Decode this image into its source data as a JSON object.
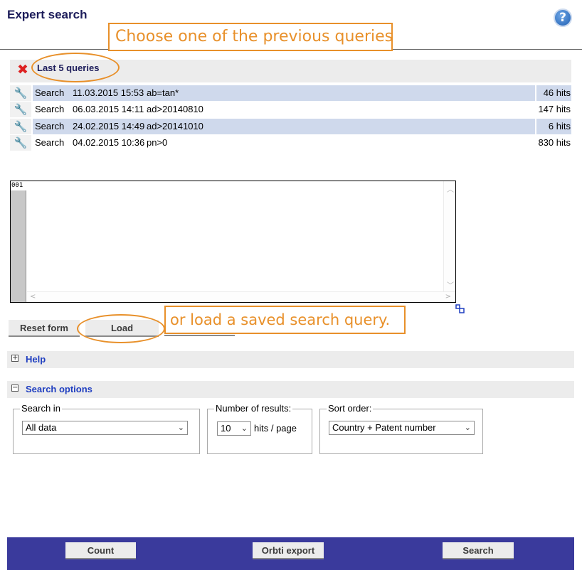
{
  "header": {
    "title": "Expert search",
    "help_glyph": "?"
  },
  "annotations": {
    "previous_queries": "Choose one of the previous queries",
    "load_saved": "or load a saved search query."
  },
  "last_queries": {
    "title": "Last 5 queries",
    "rows": [
      {
        "action": "Search",
        "date": "11.03.2015 15:53",
        "query": "ab=tan*",
        "hits": "46 hits"
      },
      {
        "action": "Search",
        "date": "06.03.2015 14:11",
        "query": "ad>20140810",
        "hits": "147 hits"
      },
      {
        "action": "Search",
        "date": "24.02.2015 14:49",
        "query": "ad>20141010",
        "hits": "6 hits"
      },
      {
        "action": "Search",
        "date": "04.02.2015 10:36",
        "query": "pn>0",
        "hits": "830 hits"
      }
    ]
  },
  "editor": {
    "line_number": "001",
    "value": ""
  },
  "form_buttons": {
    "reset": "Reset form",
    "load": "Load"
  },
  "sections": {
    "help": "Help",
    "search_options": "Search options"
  },
  "options": {
    "search_in": {
      "legend": "Search in",
      "selected": "All data"
    },
    "results": {
      "legend": "Number of results:",
      "selected": "10",
      "suffix": "hits / page"
    },
    "sort": {
      "legend": "Sort order:",
      "selected": "Country + Patent number"
    }
  },
  "footer": {
    "count": "Count",
    "orbti_export": "Orbti export",
    "search": "Search"
  },
  "colors": {
    "accent_orange": "#e8902a",
    "title_navy": "#1c1c5a",
    "link_blue": "#1f3ec0",
    "footer_bar": "#3a3a9c",
    "row_highlight": "#cfd9ec"
  },
  "icons": {
    "help": "help-icon",
    "remove": "close-x-icon",
    "row_action": "wrench-icon",
    "expand": "plus-box-icon",
    "collapse": "minus-box-icon",
    "dropdown": "chevron-down-icon",
    "resize": "resize-handle-icon"
  }
}
